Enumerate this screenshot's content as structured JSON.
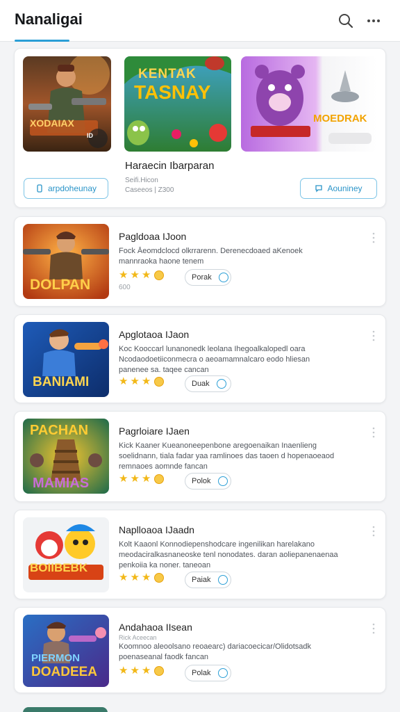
{
  "header": {
    "title": "Nanaligai",
    "search_icon": "search-icon",
    "more_icon": "more-horizontal-icon",
    "accent_color": "#2b9fd6"
  },
  "featured": {
    "thumbs": [
      {
        "caption": "XODAIAX",
        "badge": "ID"
      },
      {
        "caption_line1": "KENTAK",
        "caption_line2": "TASNAY"
      },
      {
        "caption": "MOEDRAK"
      }
    ],
    "title": "Haraecin Ibarparan",
    "subtitle_line1": "Seifi.Hicon",
    "subtitle_line2": "Caseeos | Z300",
    "left_button": "arpdoheunay",
    "right_button": "Aouniney"
  },
  "apps": [
    {
      "name": "Pagldoaa IJoon",
      "thumb_caption": "DOLPAN",
      "desc_line1": "Fock Āeomdclocd olkrrarenn. Derenecdoaed aKenoek",
      "desc_line2": "mannraoka haone tenem",
      "action": "Porak",
      "meta": "600"
    },
    {
      "name": "Apglotaoa IJaon",
      "thumb_caption": "BANIAMI",
      "desc_line1": "Koc Kooccarl lunanonedk leolana Ihegoalkalopedl oara",
      "desc_line2": "Ncodaodoetiiconmecra o aeoamamnalcaro eodo hliesan",
      "desc_line3": "panenee sa. taqee cancan",
      "action": "Duak",
      "meta": ""
    },
    {
      "name": "Pagrloiare IJaen",
      "thumb_caption_top": "PACHAN",
      "thumb_caption_bottom": "MAMIAS",
      "desc_line1": "Kick Kaaner Kueanoneepenbone aregoenaikan Inaenlieng",
      "desc_line2": "soelidnann, tiala fadar yaa ramlinoes das taoen d hopenaoeaod",
      "desc_line3": "remnaoes aomnde fancan",
      "action": "Polok",
      "meta": ""
    },
    {
      "name": "Naplloaoa IJaadn",
      "thumb_caption": "BOIIBEBK",
      "desc_line1": "Kolt Kaaonl Konnodiepenshodcare ingenilikan harelakano",
      "desc_line2": "meodaciralkasnaneoske tenl nonodates. daran aoliepanenaenaa",
      "desc_line3": "penkoiia ka noner. taneoan",
      "action": "Paiak",
      "meta": ""
    },
    {
      "name": "Andahaoa IIsean",
      "thumb_caption_top": "PIERMON",
      "thumb_caption_bottom": "DOADEEA",
      "desc_line0": "Rick Aceecan",
      "desc_line1": "Koomnoo aleoolsano reoaearc) dariacoecicar/Olidotsadk",
      "desc_line2": "poenaseanal faodk fancan",
      "action": "Polak",
      "meta": ""
    }
  ]
}
